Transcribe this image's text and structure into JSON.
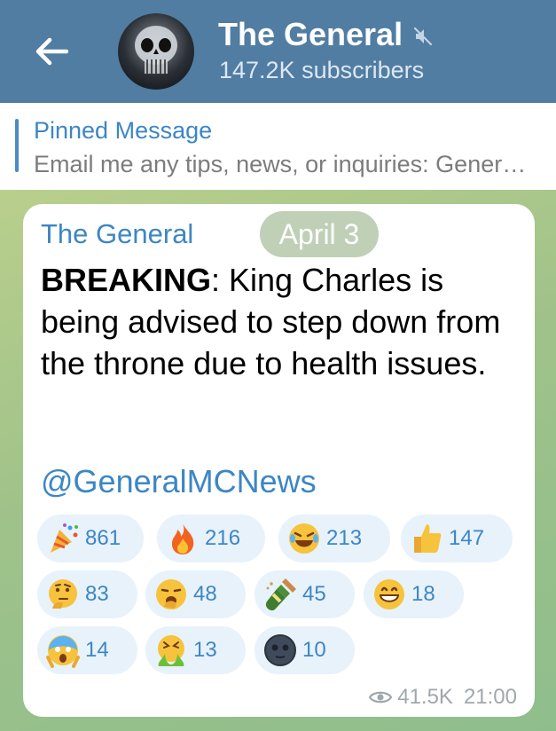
{
  "header": {
    "back_icon": "arrow-left-icon",
    "title": "The General",
    "muted_icon": "muted-speaker-icon",
    "subscribers": "147.2K subscribers",
    "bg_color": "#517da2"
  },
  "pinned": {
    "title": "Pinned Message",
    "text": "Email me any tips, news, or inquiries:  Gener…",
    "accent_color": "#3d86c4"
  },
  "message": {
    "author": "The General",
    "date_label": "April 3",
    "body_bold": "BREAKING",
    "body_rest": ": King Charles is being advised to step down from the throne due to health issues.",
    "mention": "@GeneralMCNews",
    "views": "41.5K",
    "time": "21:00",
    "views_icon": "eye-icon"
  },
  "reactions": [
    {
      "icon": "party-popper-icon",
      "count": "861"
    },
    {
      "icon": "fire-icon",
      "count": "216"
    },
    {
      "icon": "rolling-laughing-face-icon",
      "count": "213"
    },
    {
      "icon": "thumbs-up-icon",
      "count": "147"
    },
    {
      "icon": "thinking-face-icon",
      "count": "83"
    },
    {
      "icon": "yawning-face-icon",
      "count": "48"
    },
    {
      "icon": "champagne-bottle-icon",
      "count": "45"
    },
    {
      "icon": "grinning-face-icon",
      "count": "18"
    },
    {
      "icon": "screaming-face-icon",
      "count": "14"
    },
    {
      "icon": "vomiting-face-icon",
      "count": "13"
    },
    {
      "icon": "new-moon-face-icon",
      "count": "10"
    }
  ]
}
